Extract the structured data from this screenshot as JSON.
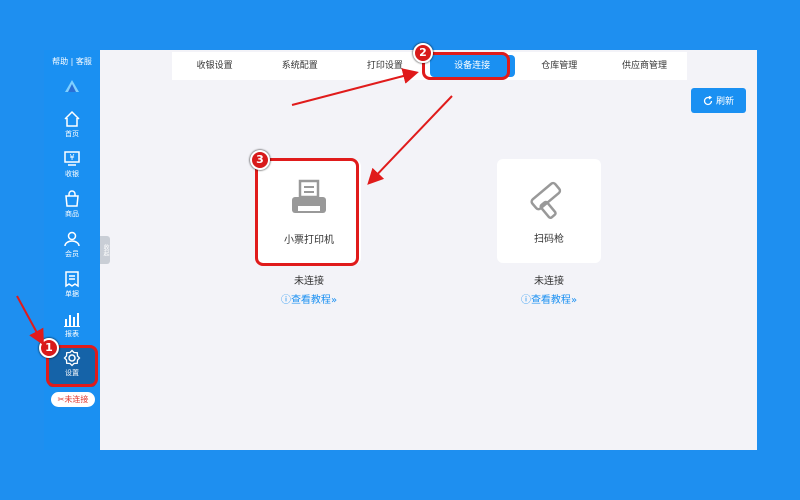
{
  "sidebar": {
    "help_label": "帮助 | 客服",
    "items": [
      {
        "label": "首页"
      },
      {
        "label": "收银"
      },
      {
        "label": "商品"
      },
      {
        "label": "会员"
      },
      {
        "label": "单据"
      },
      {
        "label": "报表"
      },
      {
        "label": "设置"
      }
    ],
    "connection_badge": "未连接",
    "collapse_label": "收起"
  },
  "tabs": [
    "收银设置",
    "系统配置",
    "打印设置",
    "设备连接",
    "仓库管理",
    "供应商管理"
  ],
  "refresh_label": "刷新",
  "devices": [
    {
      "label": "小票打印机",
      "status": "未连接",
      "tutorial": "查看教程"
    },
    {
      "label": "扫码枪",
      "status": "未连接",
      "tutorial": "查看教程"
    }
  ],
  "steps": [
    "1",
    "2",
    "3"
  ],
  "colors": {
    "primary": "#1a90f2",
    "annotation": "#e01b1b"
  }
}
